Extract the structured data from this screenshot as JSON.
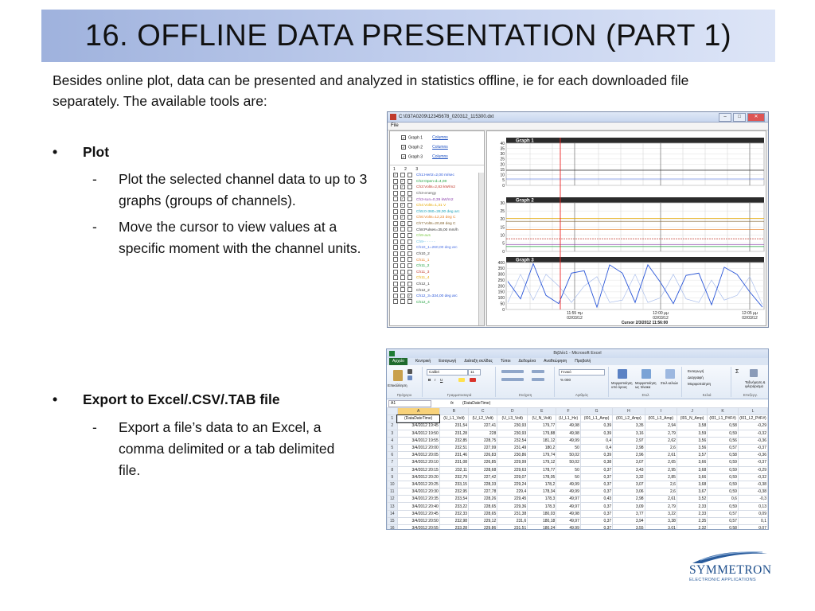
{
  "slide": {
    "title": "16. OFFLINE DATA PRESENTATION (PART 1)",
    "intro": "Besides online plot, data can be presented and analyzed in statistics offline, ie for each downloaded file separately. The available tools are:",
    "bullets": [
      {
        "label": "Plot",
        "subs": [
          "Plot the selected channel data to up to 3 graphs (groups of channels).",
          "Move the cursor to view values at a specific moment with the channel units."
        ]
      },
      {
        "label": "Export to Excel/.CSV/.TAB file",
        "subs": [
          "Export a file’s data to an Excel, a comma delimited or a tab delimited file."
        ]
      }
    ],
    "bullet_char": "•",
    "dash_char": "-"
  },
  "plot_app": {
    "window_title": "C:\\037A0209\\12345678_020312_115300.dxt",
    "menu": "File",
    "win_buttons": [
      "–",
      "□",
      "✕"
    ],
    "graph_select": [
      {
        "label": "Graph 1",
        "link": "Columns"
      },
      {
        "label": "Graph 2",
        "link": "Columns"
      },
      {
        "label": "Graph 3",
        "link": "Columns"
      }
    ],
    "channel_header": "1 2 3",
    "channels": [
      {
        "name": "Ch1:Hertz=2,00 m/sec",
        "color": "#2a56d8",
        "checks": [
          1,
          0,
          0
        ]
      },
      {
        "name": "Ch2:Open-d=4,00",
        "color": "#1b9e3a",
        "checks": [
          0,
          1,
          0
        ]
      },
      {
        "name": "Ch3:Volts=2,83 kW/m2",
        "color": "#c0392b",
        "checks": [
          0,
          1,
          0
        ]
      },
      {
        "name": "Ch3-energy",
        "color": "#555555",
        "checks": [
          0,
          0,
          0
        ]
      },
      {
        "name": "Ch3-sun=0,39 kW/m2",
        "color": "#8e44ad",
        "checks": [
          0,
          1,
          0
        ]
      },
      {
        "name": "Ch4:Volts=1,31 V",
        "color": "#e6a800",
        "checks": [
          0,
          1,
          0
        ]
      },
      {
        "name": "Ch5:0-360=28,00 deg arc",
        "color": "#16a0b8",
        "checks": [
          0,
          1,
          0
        ]
      },
      {
        "name": "Ch6:Volts=12,23 deg C",
        "color": "#e67e22",
        "checks": [
          0,
          1,
          0
        ]
      },
      {
        "name": "Ch7:Volts=20,69 deg C",
        "color": "#7f5f2a",
        "checks": [
          0,
          1,
          0
        ]
      },
      {
        "name": "Ch8:Pulses=35,00 mm/h",
        "color": "#333333",
        "checks": [
          1,
          0,
          0
        ]
      },
      {
        "name": "Ch9-avs",
        "color": "#7ac943",
        "checks": [
          0,
          0,
          0
        ]
      },
      {
        "name": "Ch9-- - - - -",
        "color": "#6ec3e6",
        "checks": [
          0,
          0,
          0
        ]
      },
      {
        "name": "Ch10_1=260,00 deg arc",
        "color": "#4a6fe3",
        "checks": [
          0,
          1,
          0
        ]
      },
      {
        "name": "Ch10_2",
        "color": "#333333",
        "checks": [
          0,
          0,
          0
        ]
      },
      {
        "name": "Ch11_1",
        "color": "#e67e22",
        "checks": [
          0,
          0,
          0
        ]
      },
      {
        "name": "Ch11_2",
        "color": "#1b9e3a",
        "checks": [
          0,
          0,
          0
        ]
      },
      {
        "name": "Ch11_3",
        "color": "#c0392b",
        "checks": [
          0,
          0,
          0
        ]
      },
      {
        "name": "Ch11_4",
        "color": "#e6a800",
        "checks": [
          0,
          0,
          0
        ]
      },
      {
        "name": "Ch12_1",
        "color": "#333333",
        "checks": [
          0,
          0,
          0
        ]
      },
      {
        "name": "Ch12_2",
        "color": "#333333",
        "checks": [
          0,
          0,
          0
        ]
      },
      {
        "name": "Ch12_3=334,00 deg arc",
        "color": "#2a56d8",
        "checks": [
          0,
          0,
          1
        ]
      },
      {
        "name": "Ch12_4",
        "color": "#1b9e3a",
        "checks": [
          0,
          0,
          0
        ]
      }
    ],
    "graphs": [
      {
        "title": "Graph 1",
        "yticks": [
          "40",
          "35",
          "30",
          "25",
          "20",
          "15",
          "10",
          "5",
          "0"
        ]
      },
      {
        "title": "Graph 2",
        "yticks": [
          "30",
          "25",
          "20",
          "15",
          "10",
          "5",
          "0"
        ]
      },
      {
        "title": "Graph 3",
        "yticks": [
          "400",
          "350",
          "300",
          "250",
          "200",
          "150",
          "100",
          "50",
          "0"
        ]
      }
    ],
    "time_labels": [
      {
        "time": "11:55 πμ",
        "date": "02/03/12"
      },
      {
        "time": "12:00 μμ",
        "date": "02/03/12"
      },
      {
        "time": "12:05 μμ",
        "date": "02/03/12"
      }
    ],
    "cursor_label": "Cursor 2/3/2012 11:56:00",
    "graph3_series": [
      240,
      90,
      390,
      120,
      50,
      310,
      330,
      20,
      380,
      310,
      60,
      380,
      230,
      50,
      290,
      310,
      40,
      360,
      300,
      150,
      20
    ],
    "graph3_series_b": [
      60,
      300,
      80,
      300,
      200,
      60,
      200,
      280,
      60,
      80,
      300,
      60,
      100,
      300,
      90,
      60,
      250,
      80,
      120,
      280,
      40
    ]
  },
  "excel": {
    "window_title": "Βιβλίο1 - Microsoft Excel",
    "tabs": [
      "Αρχείο",
      "Κεντρική",
      "Εισαγωγή",
      "Διάταξη σελίδας",
      "Τύποι",
      "Δεδομένα",
      "Αναθεώρηση",
      "Προβολή"
    ],
    "ribbon": {
      "paste": "Επικόλληση",
      "clipboard": "Πρόχειρο",
      "font_name": "Calibri",
      "font_size": "11",
      "font_group": "Γραμματοσειρά",
      "align_group": "Στοίχιση",
      "number_format": "Γενικό",
      "number_group": "Αριθμός",
      "styles_group": "Στυλ",
      "cond_format": "Μορφοποίηση υπό όρους",
      "table_format": "Μορφοποίηση ως πίνακα",
      "cell_styles": "Στυλ κελιών",
      "insert": "Εισαγωγή",
      "delete": "Διαγραφή",
      "format": "Μορφοποίηση",
      "cells_group": "Κελιά",
      "sort": "Ταξινόμηση & φιλτράρισμα",
      "edit_group": "Επεξεργ."
    },
    "name_box": "A1",
    "formula": "(DataDateTime)",
    "columns": [
      "A",
      "B",
      "C",
      "D",
      "E",
      "F",
      "G",
      "H",
      "I",
      "J",
      "K",
      "L"
    ],
    "headers": [
      "(DataDateTime)",
      "(U_L1_Volt)",
      "(U_L2_Volt)",
      "(U_L3_Volt)",
      "(U_N_Volt)",
      "(U_L1_Hz)",
      "(I01_L1_Amp)",
      "(I01_L2_Amp)",
      "(I01_L3_Amp)",
      "(I01_N_Amp)",
      "(I01_L1_P#F#)",
      "(I01_L2_P#F#)"
    ],
    "rows": [
      [
        "3/4/2012 19:45",
        "231,54",
        "227,41",
        "230,93",
        "179,77",
        "49,98",
        "0,39",
        "3,35",
        "2,94",
        "3,58",
        "0,58",
        "-0,29"
      ],
      [
        "3/4/2012 19:50",
        "231,28",
        "228",
        "230,93",
        "179,88",
        "49,98",
        "0,39",
        "3,16",
        "2,79",
        "3,59",
        "0,59",
        "-0,32"
      ],
      [
        "3/4/2012 19:55",
        "232,85",
        "228,75",
        "232,54",
        "181,12",
        "49,99",
        "0,4",
        "2,97",
        "2,62",
        "3,56",
        "0,56",
        "-0,36"
      ],
      [
        "3/4/2012 20:00",
        "232,51",
        "227,99",
        "231,49",
        "180,2",
        "50",
        "0,4",
        "2,98",
        "2,6",
        "3,56",
        "0,57",
        "-0,37"
      ],
      [
        "3/4/2012 20:05",
        "231,46",
        "226,83",
        "230,86",
        "179,74",
        "50,02",
        "0,39",
        "2,96",
        "2,61",
        "3,57",
        "0,58",
        "-0,36"
      ],
      [
        "3/4/2012 20:10",
        "231,08",
        "226,85",
        "229,99",
        "179,12",
        "50,02",
        "0,38",
        "3,07",
        "2,65",
        "3,66",
        "0,59",
        "-0,37"
      ],
      [
        "3/4/2012 20:15",
        "232,11",
        "228,68",
        "229,63",
        "178,77",
        "50",
        "0,37",
        "3,43",
        "2,95",
        "3,68",
        "0,59",
        "-0,29"
      ],
      [
        "3/4/2012 20:20",
        "232,79",
        "227,42",
        "229,07",
        "178,05",
        "50",
        "0,37",
        "3,32",
        "2,85",
        "3,66",
        "0,59",
        "-0,32"
      ],
      [
        "3/4/2012 20:25",
        "233,15",
        "228,33",
        "229,24",
        "178,2",
        "49,99",
        "0,37",
        "3,07",
        "2,6",
        "3,68",
        "0,59",
        "-0,38"
      ],
      [
        "3/4/2012 20:30",
        "232,95",
        "227,78",
        "229,4",
        "178,34",
        "49,99",
        "0,37",
        "3,06",
        "2,6",
        "3,67",
        "0,59",
        "-0,38"
      ],
      [
        "3/4/2012 20:35",
        "233,54",
        "228,26",
        "229,45",
        "178,3",
        "49,97",
        "0,43",
        "2,98",
        "2,61",
        "3,52",
        "0,6",
        "-0,3"
      ],
      [
        "3/4/2012 20:40",
        "233,22",
        "228,65",
        "229,36",
        "178,3",
        "49,97",
        "0,37",
        "3,09",
        "2,79",
        "2,33",
        "0,59",
        "0,13"
      ],
      [
        "3/4/2012 20:45",
        "232,33",
        "228,65",
        "231,38",
        "180,03",
        "49,98",
        "0,37",
        "3,77",
        "3,22",
        "2,33",
        "0,57",
        "0,09"
      ],
      [
        "3/4/2012 20:50",
        "232,98",
        "229,12",
        "231,6",
        "180,18",
        "49,97",
        "0,37",
        "3,94",
        "3,38",
        "2,35",
        "0,57",
        "0,1"
      ],
      [
        "3/4/2012 20:55",
        "233,28",
        "229,86",
        "231,51",
        "180,24",
        "49,99",
        "0,37",
        "3,55",
        "3,01",
        "2,32",
        "0,58",
        "0,07"
      ]
    ]
  },
  "logo": {
    "name": "SYMMETRON",
    "tagline": "ELECTRONIC APPLICATIONS",
    "color": "#1e4f8c"
  }
}
